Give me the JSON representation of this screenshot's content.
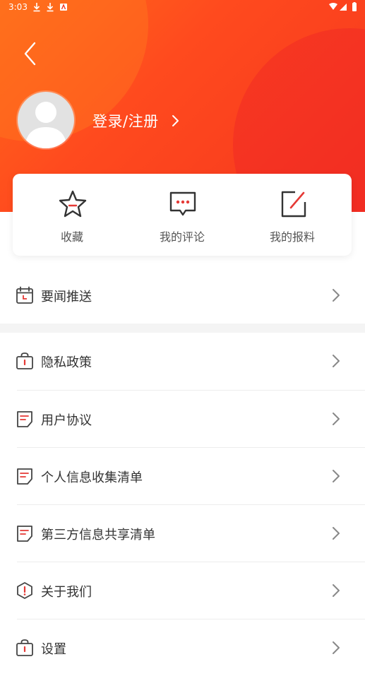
{
  "status_bar": {
    "time": "3:03"
  },
  "profile": {
    "login_label": "登录/注册"
  },
  "quick_actions": [
    {
      "label": "收藏"
    },
    {
      "label": "我的评论"
    },
    {
      "label": "我的报料"
    }
  ],
  "menu": [
    {
      "label": "要闻推送"
    },
    {
      "label": "隐私政策"
    },
    {
      "label": "用户协议"
    },
    {
      "label": "个人信息收集清单"
    },
    {
      "label": "第三方信息共享清单"
    },
    {
      "label": "关于我们"
    },
    {
      "label": "设置"
    }
  ],
  "colors": {
    "header": "#f5361f",
    "accent": "#e53935",
    "icon": "#444444"
  }
}
